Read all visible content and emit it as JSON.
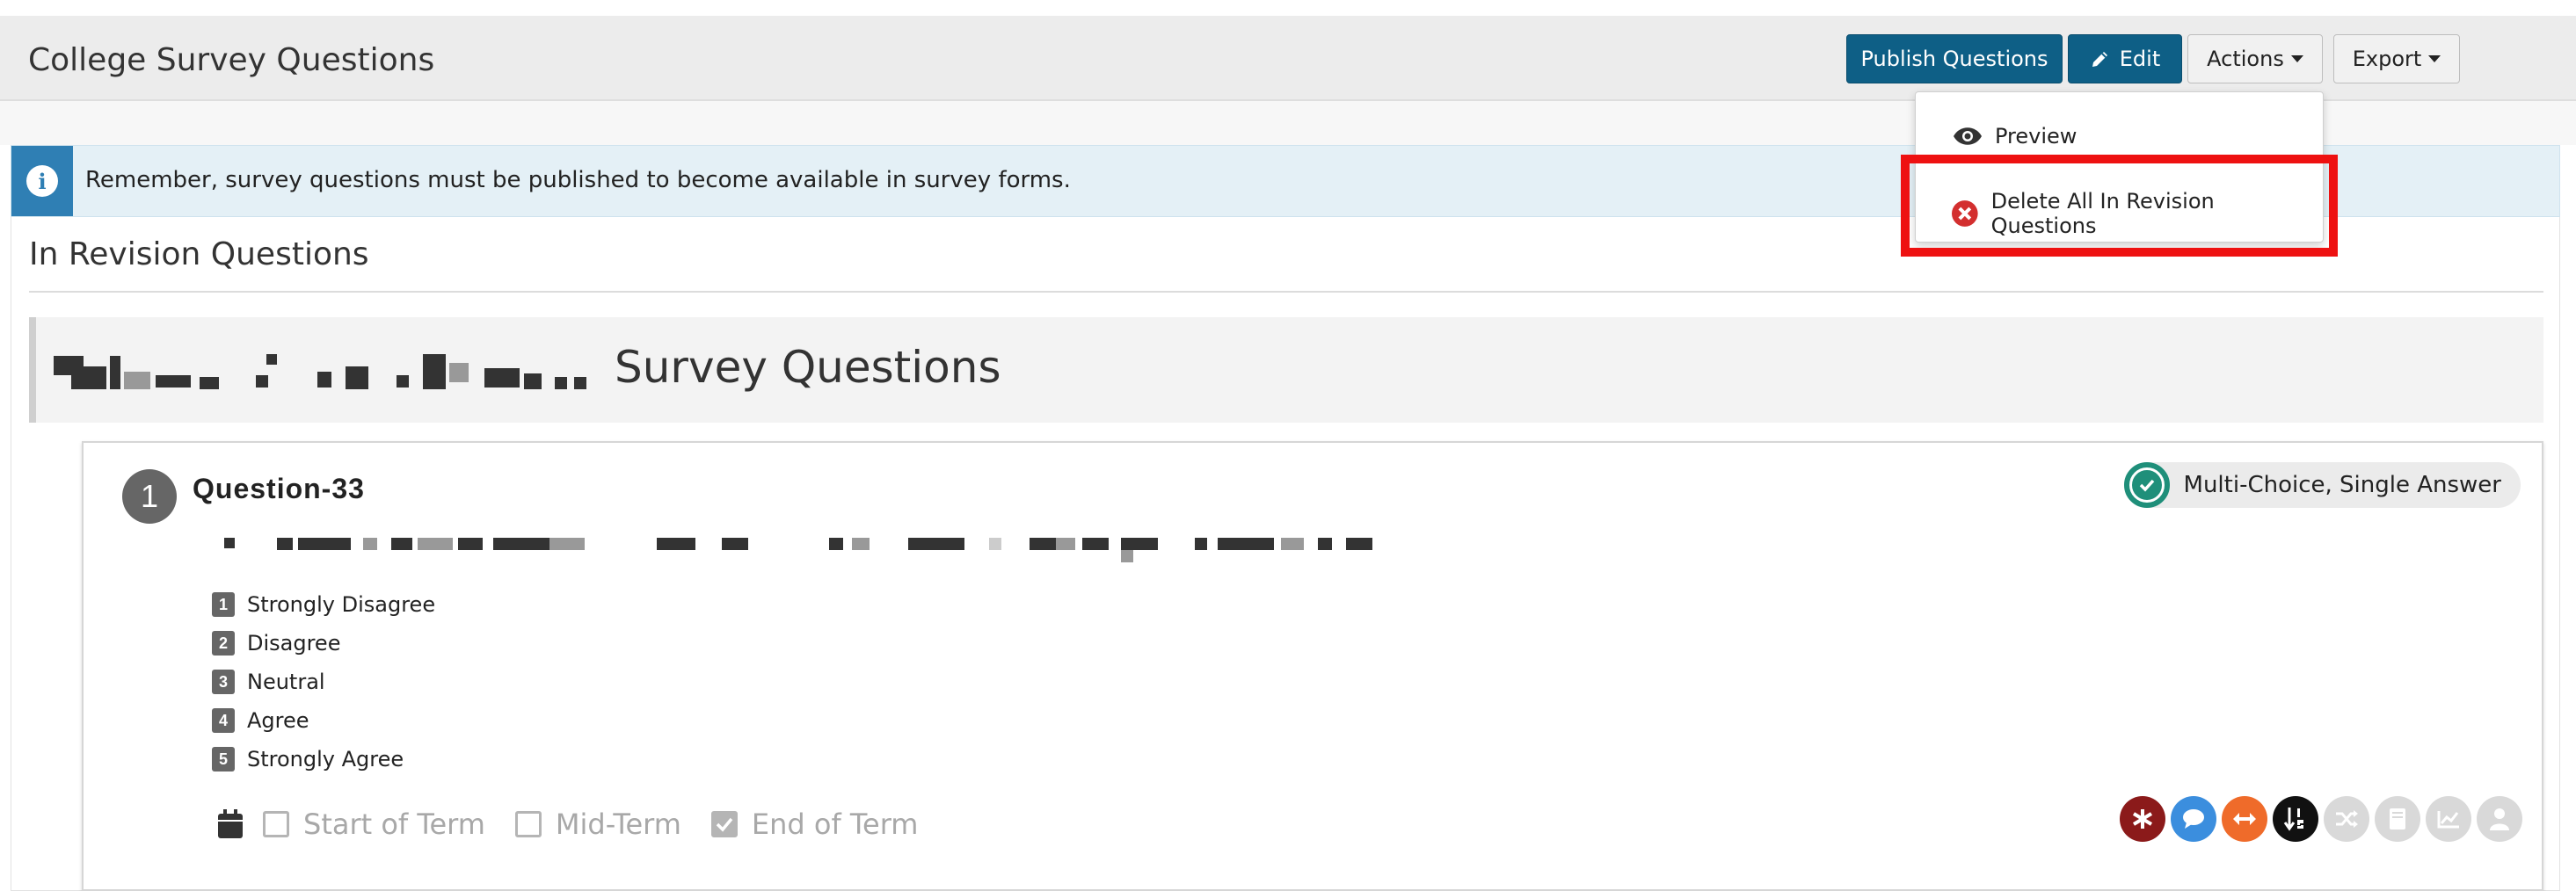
{
  "header": {
    "title": "College Survey Questions",
    "publish_label": "Publish Questions",
    "edit_label": "Edit",
    "actions_label": "Actions",
    "export_label": "Export"
  },
  "actions_menu": {
    "items": [
      {
        "label": "Preview",
        "icon": "eye-icon"
      },
      {
        "label": "Delete All In Revision Questions",
        "icon": "delete-circle-icon"
      }
    ]
  },
  "alert": {
    "text": "Remember, survey questions must be published to become available in survey forms."
  },
  "panel": {
    "title": "In Revision Questions",
    "section_title_suffix": "Survey Questions"
  },
  "question": {
    "number": "1",
    "title": "Question-33",
    "type_label": "Multi-Choice, Single Answer",
    "answers": [
      {
        "num": "1",
        "label": "Strongly Disagree"
      },
      {
        "num": "2",
        "label": "Disagree"
      },
      {
        "num": "3",
        "label": "Neutral"
      },
      {
        "num": "4",
        "label": "Agree"
      },
      {
        "num": "5",
        "label": "Strongly Agree"
      }
    ],
    "terms": [
      {
        "label": "Start of Term",
        "checked": false
      },
      {
        "label": "Mid-Term",
        "checked": false
      },
      {
        "label": "End of Term",
        "checked": true
      }
    ]
  },
  "colors": {
    "primary": "#0e5f86",
    "info": "#2f7fb4",
    "highlight": "#ee1111",
    "flag_required": "#8b1a1a",
    "flag_comment": "#3b8ede",
    "flag_range": "#ef6b2a",
    "flag_sort": "#111111",
    "flag_disabled": "#d9d9d9"
  }
}
